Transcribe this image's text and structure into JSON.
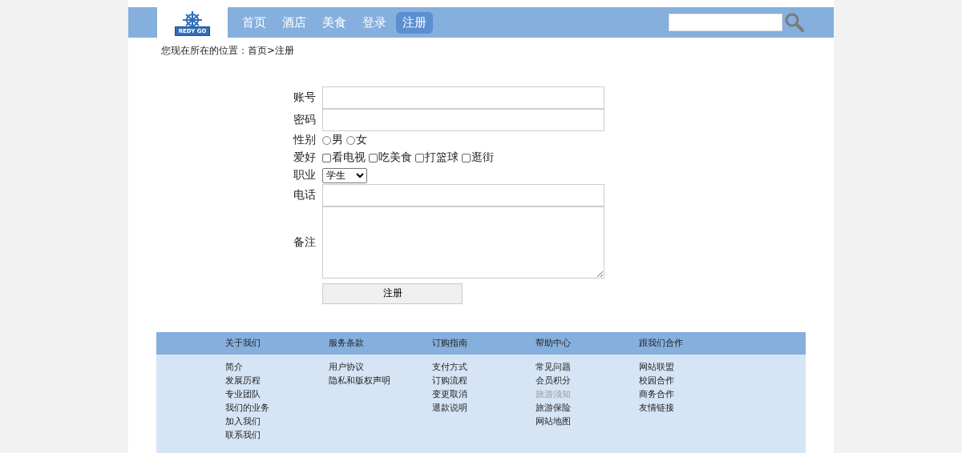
{
  "header": {
    "logo": {
      "text": "REDY GO"
    },
    "nav": [
      {
        "label": "首页",
        "selected": false
      },
      {
        "label": "酒店",
        "selected": false
      },
      {
        "label": "美食",
        "selected": false
      },
      {
        "label": "登录",
        "selected": false
      },
      {
        "label": "注册",
        "selected": true
      }
    ]
  },
  "breadcrumb": "您现在所在的位置：首页>注册",
  "form": {
    "fields": [
      {
        "kind": "text",
        "label": "账号"
      },
      {
        "kind": "text",
        "label": "密码"
      },
      {
        "kind": "radio",
        "label": "性别",
        "options": [
          {
            "label": "男",
            "selected": false
          },
          {
            "label": "女",
            "selected": false
          }
        ]
      },
      {
        "kind": "checkbox",
        "label": "爱好",
        "options": [
          {
            "label": "看电视",
            "checked": false
          },
          {
            "label": "吃美食",
            "checked": false
          },
          {
            "label": "打篮球",
            "checked": false
          },
          {
            "label": "逛街",
            "checked": false
          }
        ]
      },
      {
        "kind": "select",
        "label": "职业",
        "value": "学生"
      },
      {
        "kind": "text",
        "label": "电话"
      },
      {
        "kind": "textarea",
        "label": "备注"
      }
    ],
    "submit": "注册"
  },
  "footer": {
    "columns": [
      {
        "title": "关于我们",
        "links": [
          {
            "label": "简介",
            "dimmed": false
          },
          {
            "label": "发展历程",
            "dimmed": false
          },
          {
            "label": "专业团队",
            "dimmed": false
          },
          {
            "label": "我们的业务",
            "dimmed": false
          },
          {
            "label": "加入我们",
            "dimmed": false
          },
          {
            "label": "联系我们",
            "dimmed": false
          }
        ]
      },
      {
        "title": "服务条款",
        "links": [
          {
            "label": "用户协议",
            "dimmed": false
          },
          {
            "label": "隐私和版权声明",
            "dimmed": false
          }
        ]
      },
      {
        "title": "订购指南",
        "links": [
          {
            "label": "支付方式",
            "dimmed": false
          },
          {
            "label": "订购流程",
            "dimmed": false
          },
          {
            "label": "变更取消",
            "dimmed": false
          },
          {
            "label": "退款说明",
            "dimmed": false
          }
        ]
      },
      {
        "title": "帮助中心",
        "links": [
          {
            "label": "常见问题",
            "dimmed": false
          },
          {
            "label": "会员积分",
            "dimmed": false
          },
          {
            "label": "旅游须知",
            "dimmed": true
          },
          {
            "label": "旅游保险",
            "dimmed": false
          },
          {
            "label": "网站地图",
            "dimmed": false
          }
        ]
      },
      {
        "title": "跟我们合作",
        "links": [
          {
            "label": "网站联盟",
            "dimmed": false
          },
          {
            "label": "校园合作",
            "dimmed": false
          },
          {
            "label": "商务合作",
            "dimmed": false
          },
          {
            "label": "友情链接",
            "dimmed": false
          }
        ]
      }
    ]
  }
}
